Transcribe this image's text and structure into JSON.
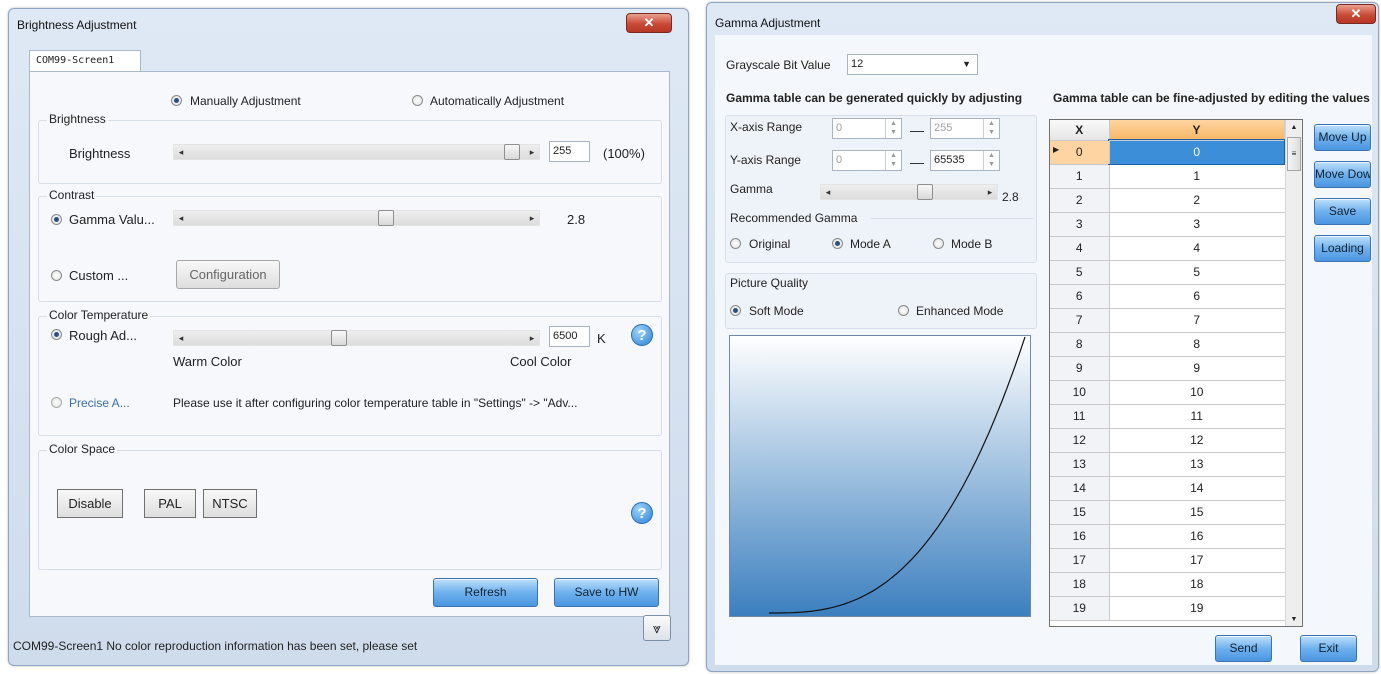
{
  "brightness_window": {
    "title": "Brightness Adjustment",
    "close_icon": "close-x-icon",
    "tab_label": "COM99-Screen1",
    "mode_manual": "Manually Adjustment",
    "mode_auto": "Automatically Adjustment",
    "mode_selected": "manual",
    "brightness": {
      "group": "Brightness",
      "label": "Brightness",
      "value": "255",
      "percent": "(100%)",
      "level_fraction": 1.0
    },
    "contrast": {
      "group": "Contrast",
      "gamma_label": "Gamma Valu...",
      "gamma_value": "2.8",
      "custom_label": "Custom ...",
      "configuration_button": "Configuration",
      "selected": "gamma"
    },
    "color_temperature": {
      "group": "Color Temperature",
      "rough_label": "Rough Ad...",
      "value": "6500",
      "unit": "K",
      "warm": "Warm Color",
      "cool": "Cool Color",
      "precise_label": "Precise A...",
      "precise_hint": "Please use it after configuring color temperature table in \"Settings\" -> \"Adv...",
      "selected": "rough"
    },
    "color_space": {
      "group": "Color Space",
      "buttons": [
        "Disable",
        "PAL",
        "NTSC"
      ]
    },
    "refresh_button": "Refresh",
    "save_hw_button": "Save to HW",
    "status": "COM99-Screen1 No color reproduction information has been set, please set"
  },
  "gamma_window": {
    "title": "Gamma Adjustment",
    "grayscale_label": "Grayscale Bit Value",
    "grayscale_value": "12",
    "quick_heading": "Gamma table can be generated quickly by adjusting",
    "fine_heading": "Gamma table can be fine-adjusted by editing the values",
    "x_axis_label": "X-axis Range",
    "x_min": "0",
    "x_max": "255",
    "y_axis_label": "Y-axis Range",
    "y_min": "0",
    "y_max": "65535",
    "gamma_label": "Gamma",
    "gamma_value": "2.8",
    "recommended": {
      "group": "Recommended Gamma",
      "options": [
        "Original",
        "Mode A",
        "Mode B"
      ],
      "selected": "Mode A"
    },
    "picture_quality": {
      "group": "Picture Quality",
      "options": [
        "Soft Mode",
        "Enhanced Mode"
      ],
      "selected": "Soft Mode"
    },
    "table": {
      "columns": [
        "X",
        "Y"
      ],
      "rows": [
        [
          "0",
          "0"
        ],
        [
          "1",
          "1"
        ],
        [
          "2",
          "2"
        ],
        [
          "3",
          "3"
        ],
        [
          "4",
          "4"
        ],
        [
          "5",
          "5"
        ],
        [
          "6",
          "6"
        ],
        [
          "7",
          "7"
        ],
        [
          "8",
          "8"
        ],
        [
          "9",
          "9"
        ],
        [
          "10",
          "10"
        ],
        [
          "11",
          "11"
        ],
        [
          "12",
          "12"
        ],
        [
          "13",
          "13"
        ],
        [
          "14",
          "14"
        ],
        [
          "15",
          "15"
        ],
        [
          "16",
          "16"
        ],
        [
          "17",
          "17"
        ],
        [
          "18",
          "18"
        ],
        [
          "19",
          "19"
        ]
      ],
      "selected_row": 0
    },
    "side_buttons": [
      "Move Up",
      "Move Dowr",
      "Save",
      "Loading"
    ],
    "send_button": "Send",
    "exit_button": "Exit"
  }
}
